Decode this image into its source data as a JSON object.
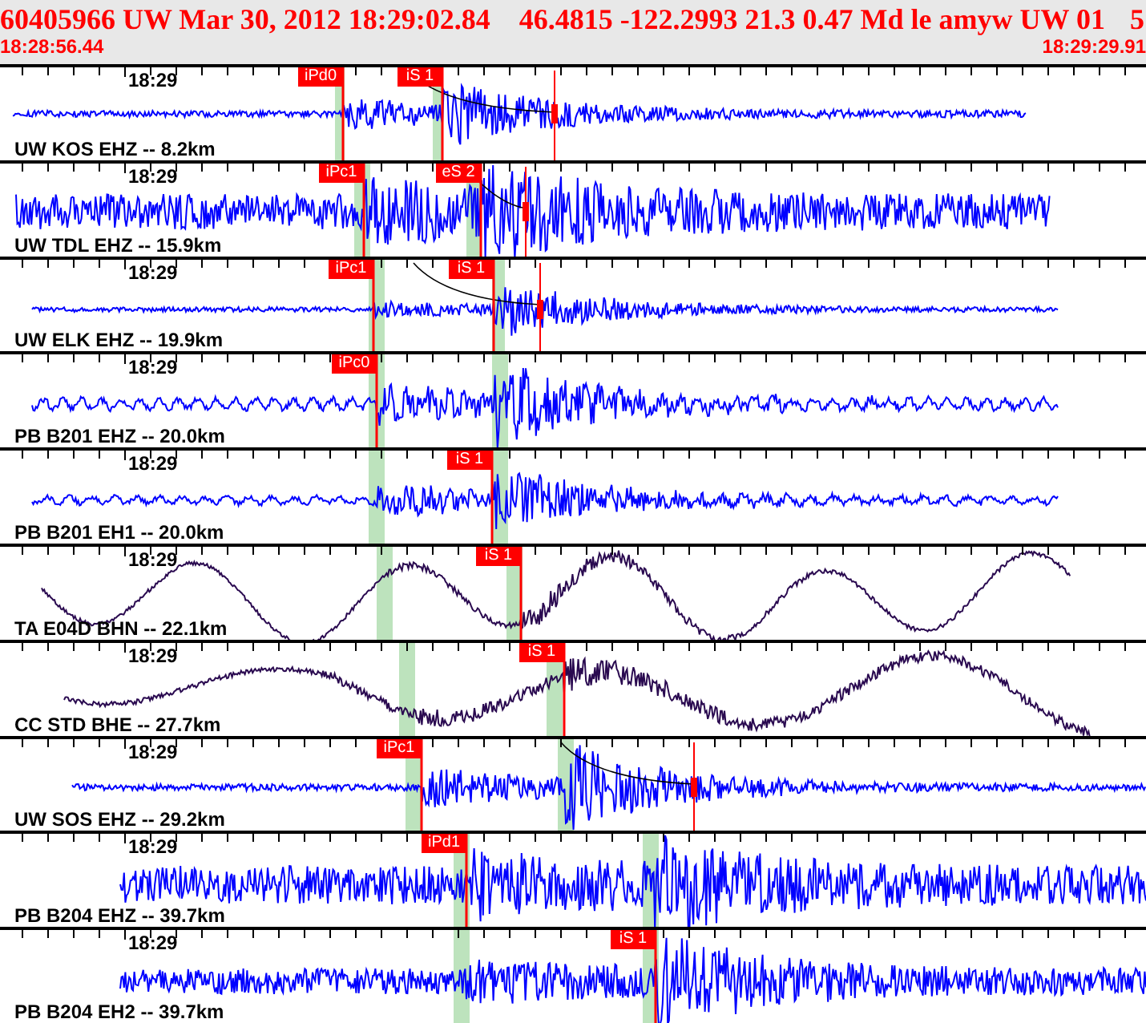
{
  "header": {
    "title": "60405966 UW Mar 30, 2012 18:29:02.84    46.4815 -122.2993 21.3 0.47 Md le amyw UW 01",
    "flag": "5",
    "start_time": "18:28:56.44",
    "end_time": "18:29:29.91"
  },
  "traces": [
    {
      "station": "UW KOS EHZ -- 8.2km",
      "time_label": "18:29",
      "color": "#0000ff",
      "picks": [
        {
          "label": "iPd0"
        },
        {
          "label": "iS 1"
        }
      ]
    },
    {
      "station": "UW TDL EHZ -- 15.9km",
      "time_label": "18:29",
      "color": "#0000ff",
      "picks": [
        {
          "label": "iPc1"
        },
        {
          "label": "eS 2"
        }
      ]
    },
    {
      "station": "UW ELK EHZ -- 19.9km",
      "time_label": "18:29",
      "color": "#0000ff",
      "picks": [
        {
          "label": "iPc1"
        },
        {
          "label": "iS 1"
        }
      ]
    },
    {
      "station": "PB B201 EHZ -- 20.0km",
      "time_label": "18:29",
      "color": "#0000ff",
      "picks": [
        {
          "label": "iPc0"
        }
      ]
    },
    {
      "station": "PB B201 EH1 -- 20.0km",
      "time_label": "18:29",
      "color": "#0000ff",
      "picks": [
        {
          "label": "iS 1"
        }
      ]
    },
    {
      "station": "TA E04D BHN -- 22.1km",
      "time_label": "18:29",
      "color": "#2a0a50",
      "picks": [
        {
          "label": "iS 1"
        }
      ]
    },
    {
      "station": "CC STD BHE -- 27.7km",
      "time_label": "18:29",
      "color": "#2a0a50",
      "picks": [
        {
          "label": "iS 1"
        }
      ]
    },
    {
      "station": "UW SOS EHZ -- 29.2km",
      "time_label": "18:29",
      "color": "#0000ff",
      "picks": [
        {
          "label": "iPc1"
        }
      ]
    },
    {
      "station": "PB B204 EHZ -- 39.7km",
      "time_label": "18:29",
      "color": "#0000ff",
      "picks": [
        {
          "label": "iPd1"
        }
      ]
    },
    {
      "station": "PB B204 EH2 -- 39.7km",
      "time_label": "18:29",
      "color": "#0000ff",
      "picks": [
        {
          "label": "iS 1"
        }
      ]
    }
  ]
}
